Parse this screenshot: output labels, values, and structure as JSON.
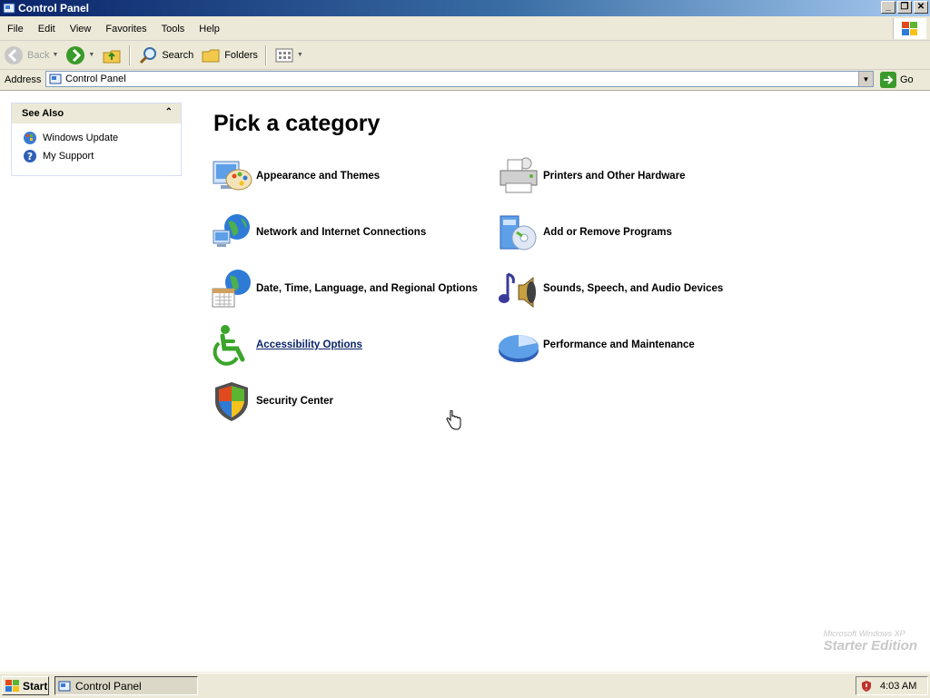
{
  "window": {
    "title": "Control Panel"
  },
  "menu": {
    "items": [
      "File",
      "Edit",
      "View",
      "Favorites",
      "Tools",
      "Help"
    ]
  },
  "toolbar": {
    "back": "Back",
    "search": "Search",
    "folders": "Folders"
  },
  "address": {
    "label": "Address",
    "value": "Control Panel",
    "go": "Go"
  },
  "see_also": {
    "title": "See Also",
    "links": [
      {
        "label": "Windows Update",
        "icon": "windows-update-icon"
      },
      {
        "label": "My Support",
        "icon": "help-icon"
      }
    ]
  },
  "main": {
    "title": "Pick a category",
    "categories": [
      {
        "label": "Appearance and Themes",
        "icon": "appearance-themes-icon"
      },
      {
        "label": "Printers and Other Hardware",
        "icon": "printer-icon"
      },
      {
        "label": "Network and Internet Connections",
        "icon": "network-globe-icon"
      },
      {
        "label": "Add or Remove Programs",
        "icon": "add-remove-programs-icon"
      },
      {
        "label": "Date, Time, Language, and Regional Options",
        "icon": "date-time-globe-icon"
      },
      {
        "label": "Sounds, Speech, and Audio Devices",
        "icon": "sound-speaker-icon"
      },
      {
        "label": "Accessibility Options",
        "icon": "accessibility-icon",
        "hovered": true
      },
      {
        "label": "Performance and Maintenance",
        "icon": "performance-pie-icon"
      },
      {
        "label": "Security Center",
        "icon": "security-shield-icon"
      }
    ]
  },
  "watermark": {
    "line1": "Microsoft Windows XP",
    "line2": "Starter Edition"
  },
  "taskbar": {
    "start": "Start",
    "window_item": "Control Panel",
    "clock": "4:03 AM"
  },
  "colors": {
    "title_bar": "#0a246a",
    "link": "#0a246a",
    "go_green": "#3a9a2a"
  }
}
